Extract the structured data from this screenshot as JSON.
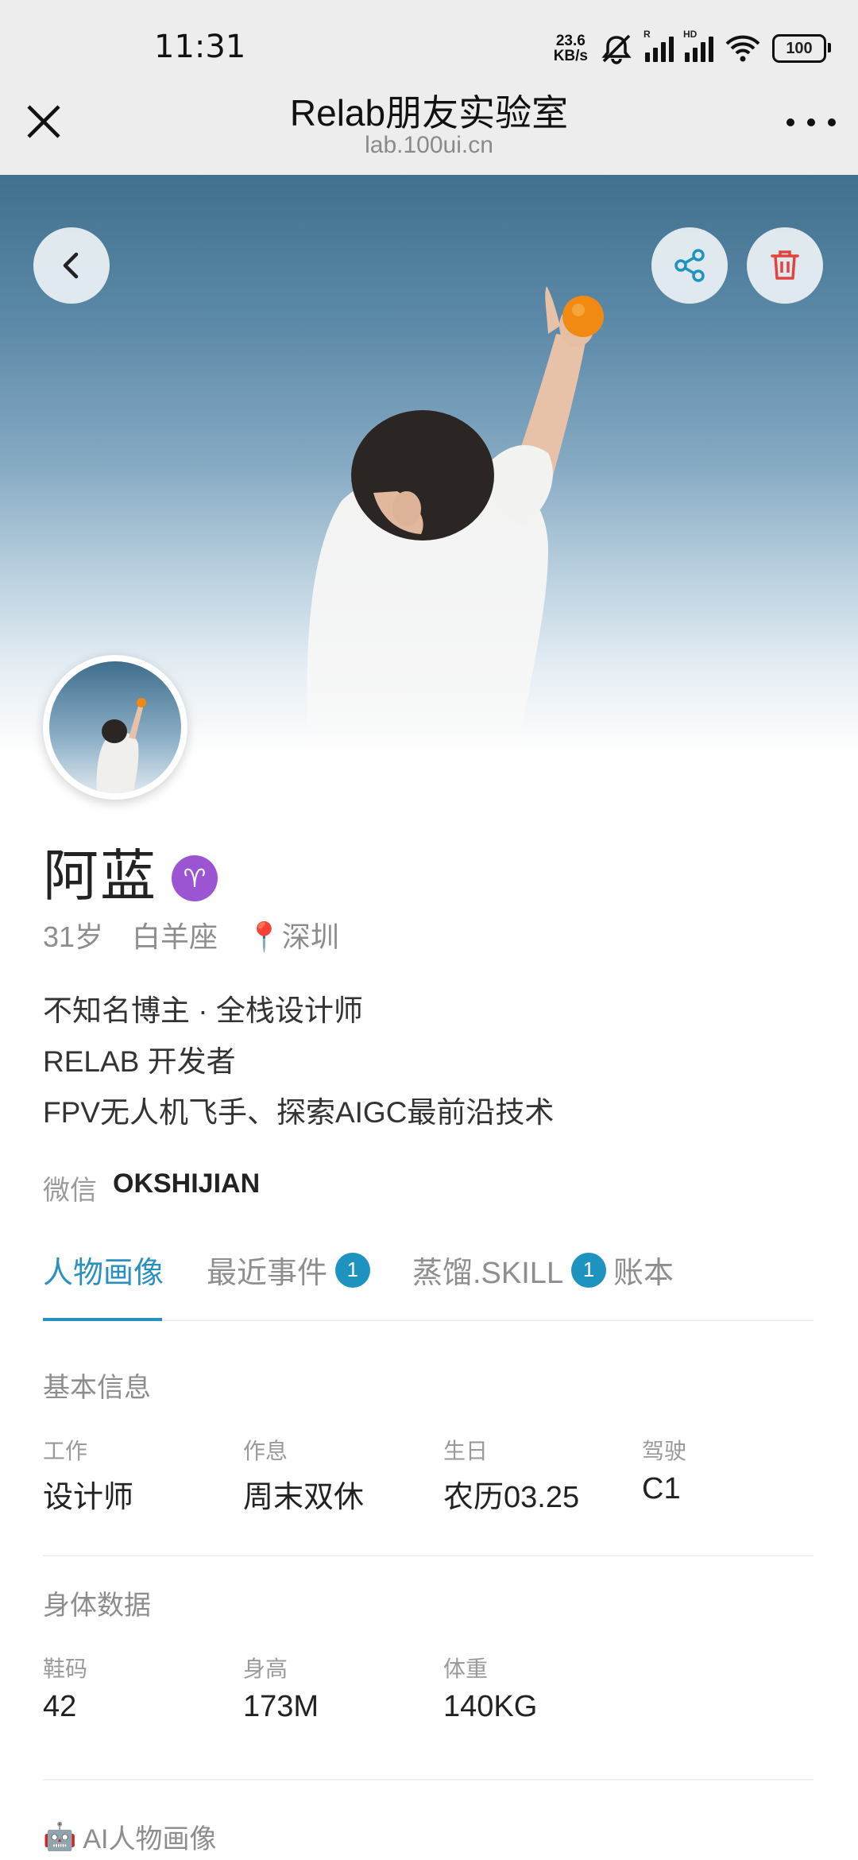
{
  "status_bar": {
    "time": "11:31",
    "net_speed_value": "23.6",
    "net_speed_unit": "KB/s",
    "sim1_tag": "R",
    "sim2_tag": "HD",
    "battery": "100"
  },
  "titlebar": {
    "title": "Relab朋友实验室",
    "subtitle": "lab.100ui.cn"
  },
  "profile": {
    "name": "阿蓝",
    "zodiac_symbol": "♈",
    "age": "31岁",
    "zodiac": "白羊座",
    "location_pin": "📍",
    "location": "深圳",
    "bio": [
      "不知名博主 · 全栈设计师",
      "RELAB 开发者",
      "FPV无人机飞手、探索AIGC最前沿技术"
    ],
    "wechat_label": "微信",
    "wechat_id": "OKSHIJIAN"
  },
  "tabs": [
    {
      "label": "人物画像",
      "active": true
    },
    {
      "label": "最近事件",
      "count": "1"
    },
    {
      "label": "蒸馏.SKILL",
      "count": "1"
    },
    {
      "label": "账本"
    }
  ],
  "basic_info": {
    "title": "基本信息",
    "fields": [
      {
        "label": "工作",
        "value": "设计师"
      },
      {
        "label": "作息",
        "value": "周末双休"
      },
      {
        "label": "生日",
        "value": "农历03.25"
      },
      {
        "label": "驾驶",
        "value": "C1"
      }
    ]
  },
  "body_data": {
    "title": "身体数据",
    "fields": [
      {
        "label": "鞋码",
        "value": "42"
      },
      {
        "label": "身高",
        "value": "173M"
      },
      {
        "label": "体重",
        "value": "140KG"
      }
    ]
  },
  "ai_portrait": {
    "icon": "🤖",
    "title": "AI人物画像"
  },
  "colors": {
    "accent": "#2a90c0",
    "badge": "#1f93c0",
    "zodiac_badge": "#9b55d3",
    "delete_red": "#e0443e",
    "sky_top": "#41708f"
  }
}
